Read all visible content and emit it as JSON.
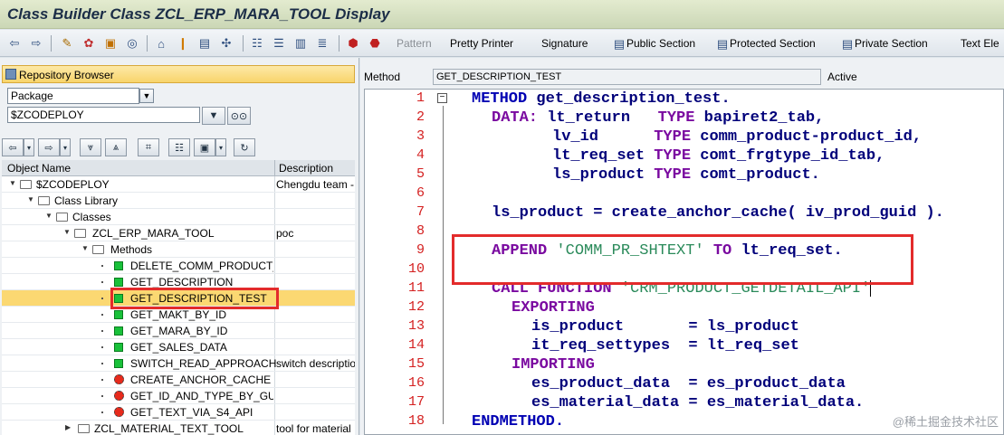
{
  "window": {
    "title": "Class Builder Class ZCL_ERP_MARA_TOOL Display"
  },
  "toolbar": {
    "pattern": "Pattern",
    "pretty_printer": "Pretty Printer",
    "signature": "Signature",
    "public_section": "Public Section",
    "protected_section": "Protected Section",
    "private_section": "Private Section",
    "text_elements": "Text Ele"
  },
  "repo": {
    "title": "Repository Browser",
    "type_value": "Package",
    "package_value": "$ZCODEPLOY"
  },
  "tree": {
    "col_name": "Object Name",
    "col_desc": "Description",
    "rows": [
      {
        "name": "$ZCODEPLOY",
        "desc": "Chengdu team -"
      },
      {
        "name": "Class Library",
        "desc": ""
      },
      {
        "name": "Classes",
        "desc": ""
      },
      {
        "name": "ZCL_ERP_MARA_TOOL",
        "desc": "poc"
      },
      {
        "name": "Methods",
        "desc": ""
      },
      {
        "name": "DELETE_COMM_PRODUCT_E",
        "desc": ""
      },
      {
        "name": "GET_DESCRIPTION",
        "desc": ""
      },
      {
        "name": "GET_DESCRIPTION_TEST",
        "desc": ""
      },
      {
        "name": "GET_MAKT_BY_ID",
        "desc": ""
      },
      {
        "name": "GET_MARA_BY_ID",
        "desc": ""
      },
      {
        "name": "GET_SALES_DATA",
        "desc": ""
      },
      {
        "name": "SWITCH_READ_APPROACH",
        "desc": "switch descriptio"
      },
      {
        "name": "CREATE_ANCHOR_CACHE",
        "desc": ""
      },
      {
        "name": "GET_ID_AND_TYPE_BY_GUI",
        "desc": ""
      },
      {
        "name": "GET_TEXT_VIA_S4_API",
        "desc": ""
      },
      {
        "name": "ZCL_MATERIAL_TEXT_TOOL",
        "desc": "tool for material"
      }
    ]
  },
  "editor": {
    "method_label": "Method",
    "method_value": "GET_DESCRIPTION_TEST",
    "status": "Active",
    "line_numbers": [
      "1",
      "2",
      "3",
      "4",
      "5",
      "6",
      "7",
      "8",
      "9",
      "10",
      "11",
      "12",
      "13",
      "14",
      "15",
      "16",
      "17",
      "18"
    ],
    "lines": {
      "l1_kw": "METHOD",
      "l1_rest": "get_description_test.",
      "l2_kw": "DATA:",
      "l2_a": "lt_return",
      "l2_kw2": "TYPE",
      "l2_b": "bapiret2_tab,",
      "l3_a": "lv_id",
      "l3_kw2": "TYPE",
      "l3_b": "comm_product-product_id,",
      "l4_a": "lt_req_set",
      "l4_kw2": "TYPE",
      "l4_b": "comt_frgtype_id_tab,",
      "l5_a": "ls_product",
      "l5_kw2": "TYPE",
      "l5_b": "comt_product.",
      "l7": "ls_product = create_anchor_cache( iv_prod_guid ).",
      "l9_kw": "APPEND",
      "l9_str": "'COMM_PR_SHTEXT'",
      "l9_kw2": "TO",
      "l9_b": "lt_req_set.",
      "l11_kw": "CALL FUNCTION",
      "l11_str": "'CRM_PRODUCT_GETDETAIL_API'",
      "l12_kw": "EXPORTING",
      "l13": "is_product       = ls_product",
      "l14": "it_req_settypes  = lt_req_set",
      "l15_kw": "IMPORTING",
      "l16": "es_product_data  = es_product_data",
      "l17": "es_material_data = es_material_data.",
      "l18_kw": "ENDMETHOD."
    }
  },
  "watermark": "@稀土掘金技术社区"
}
